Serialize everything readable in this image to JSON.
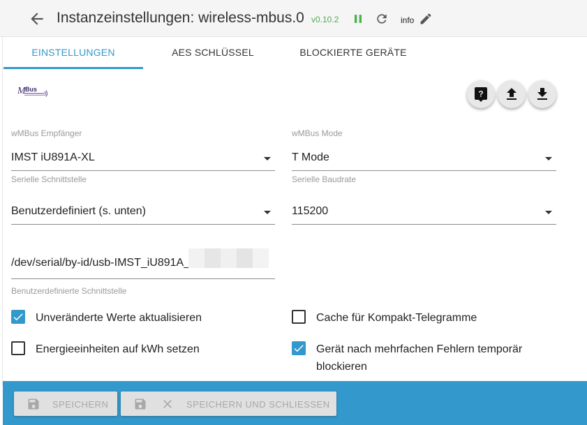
{
  "header": {
    "title": "Instanzeinstellungen: wireless-mbus.0",
    "version": "v0.10.2",
    "info_label": "info",
    "colors": {
      "version": "#4caf50",
      "running": "#4caf50"
    }
  },
  "tabs": [
    {
      "label": "EINSTELLUNGEN",
      "active": true
    },
    {
      "label": "AES SCHLÜSSEL",
      "active": false
    },
    {
      "label": "BLOCKIERTE GERÄTE",
      "active": false
    }
  ],
  "logo": {
    "text": "M-Bus",
    "icon": "mbus-logo-icon"
  },
  "fabs": [
    {
      "icon": "help-icon"
    },
    {
      "icon": "upload-icon"
    },
    {
      "icon": "download-icon"
    }
  ],
  "form": {
    "receiver": {
      "label": "wMBus Empfänger",
      "value": "IMST iU891A-XL"
    },
    "mode": {
      "label": "wMBus Mode",
      "value": "T Mode"
    },
    "serial_port": {
      "label": "Serielle Schnittstelle",
      "value": "Benutzerdefiniert (s. unten)"
    },
    "baudrate": {
      "label": "Serielle Baudrate",
      "value": "115200"
    },
    "custom_port": {
      "value": "/dev/serial/by-id/usb-IMST_iU891A_",
      "label": "Benutzerdefinierte Schnittstelle"
    },
    "checkboxes": [
      {
        "label": "Unveränderte Werte aktualisieren",
        "checked": true
      },
      {
        "label": "Cache für Kompakt-Telegramme",
        "checked": false
      },
      {
        "label": "Energieeinheiten auf kWh setzen",
        "checked": false
      },
      {
        "label": "Gerät nach mehrfachen Fehlern temporär blockieren",
        "checked": true
      }
    ]
  },
  "footer": {
    "save_label": "SPEICHERN",
    "save_close_label": "SPEICHERN UND SCHLIESSEN"
  },
  "colors": {
    "accent": "#3399cc"
  }
}
